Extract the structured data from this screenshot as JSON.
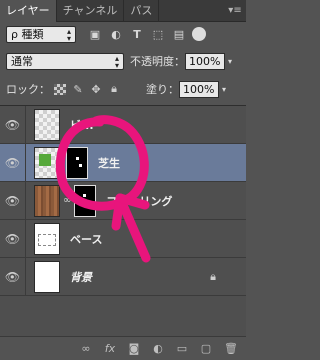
{
  "tabs": {
    "layers": "レイヤー",
    "channels": "チャンネル",
    "paths": "パス",
    "menu": "▾≡"
  },
  "filter": {
    "kind_label": "ρ 種類"
  },
  "blend": {
    "mode": "通常",
    "opacity_label": "不透明度：",
    "opacity_value": "100%"
  },
  "lock": {
    "label": "ロック：",
    "fill_label": "塗り：",
    "fill_value": "100%"
  },
  "layers": [
    {
      "name": "ビ...",
      "thumb": "checker",
      "has_mask": false,
      "italic": false,
      "locked": false
    },
    {
      "name": "芝生",
      "thumb": "grass",
      "has_mask": true,
      "italic": false,
      "locked": false,
      "selected": true
    },
    {
      "name": "フローリング",
      "thumb": "wood",
      "has_mask": true,
      "italic": false,
      "locked": false
    },
    {
      "name": "ベース",
      "thumb": "dash",
      "has_mask": false,
      "italic": false,
      "locked": false
    },
    {
      "name": "背景",
      "thumb": "white",
      "has_mask": false,
      "italic": true,
      "locked": true
    }
  ],
  "annotation_color": "#e8157c"
}
